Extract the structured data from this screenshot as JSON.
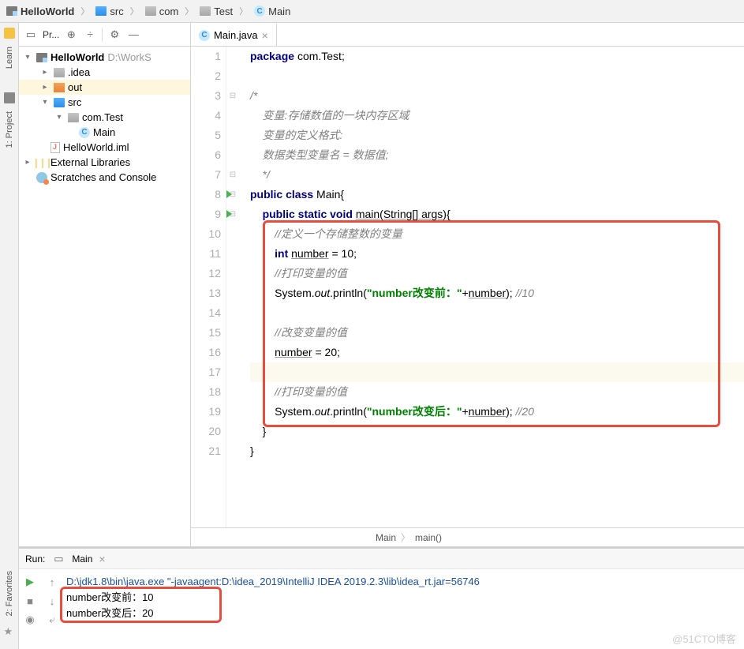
{
  "breadcrumb": [
    {
      "icon": "project",
      "label": "HelloWorld",
      "bold": true
    },
    {
      "icon": "folder-blue",
      "label": "src"
    },
    {
      "icon": "folder-gray",
      "label": "com"
    },
    {
      "icon": "folder-gray",
      "label": "Test"
    },
    {
      "icon": "java",
      "label": "Main"
    }
  ],
  "left_strip": {
    "learn": "Learn",
    "project": "1: Project",
    "favorites": "2: Favorites"
  },
  "toolbar": {
    "project_label": "Pr..."
  },
  "tab": {
    "label": "Main.java"
  },
  "tree": {
    "root": {
      "label": "HelloWorld",
      "path": "D:\\WorkS"
    },
    "idea": ".idea",
    "out": "out",
    "src": "src",
    "pkg": "com.Test",
    "main": "Main",
    "iml": "HelloWorld.iml",
    "libs": "External Libraries",
    "scratch": "Scratches and Console"
  },
  "code": {
    "l1": "package com.Test;",
    "l3": "/*",
    "l4": "    变量:存储数值的一块内存区域",
    "l5": "    变量的定义格式:",
    "l6": "    数据类型变量名 = 数据值;",
    "l7": "    */",
    "l8_a": "public class ",
    "l8_b": "Main{",
    "l9_a": "public static void ",
    "l9_b": "main",
    "l9_c": "(String[] args){",
    "l10": "//定义一个存储整数的变量",
    "l11_a": "int ",
    "l11_b": "number",
    "l11_c": " = 10;",
    "l12": "//打印变量的值",
    "l13_a": "System.",
    "l13_b": "out",
    "l13_c": ".println(",
    "l13_d": "\"number改变前：\"",
    "l13_e": "+",
    "l13_f": "number",
    "l13_g": "); ",
    "l13_h": "//10",
    "l15": "//改变变量的值",
    "l16_a": "number",
    "l16_b": " = 20;",
    "l18": "//打印变量的值",
    "l19_a": "System.",
    "l19_b": "out",
    "l19_c": ".println(",
    "l19_d": "\"number改变后：\"",
    "l19_e": "+",
    "l19_f": "number",
    "l19_g": "); ",
    "l19_h": "//20",
    "l20": "}",
    "l21": "}"
  },
  "editor_bc": {
    "a": "Main",
    "b": "main()"
  },
  "run": {
    "header": "Run:",
    "config": "Main",
    "cmd": "D:\\jdk1.8\\bin\\java.exe \"-javaagent:D:\\idea_2019\\IntelliJ IDEA 2019.2.3\\lib\\idea_rt.jar=56746",
    "out1": "number改变前：10",
    "out2": "number改变后：20"
  },
  "watermark": "@51CTO博客"
}
